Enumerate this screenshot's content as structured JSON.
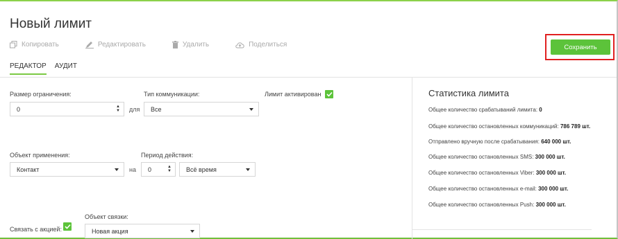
{
  "page": {
    "title": "Новый лимит"
  },
  "toolbar": {
    "copy": "Копировать",
    "edit": "Редактировать",
    "delete": "Удалить",
    "share": "Поделиться"
  },
  "save_label": "Сохранить",
  "tabs": [
    {
      "label": "РЕДАКТОР",
      "active": true
    },
    {
      "label": "АУДИТ",
      "active": false
    }
  ],
  "form": {
    "limit_size": {
      "label": "Размер ограничения:",
      "value": "0"
    },
    "for_label": "для",
    "comm_type": {
      "label": "Тип коммуникации:",
      "value": "Все"
    },
    "limit_active": {
      "label": "Лимит активирован",
      "checked": true
    },
    "apply_object": {
      "label": "Объект применения:",
      "value": "Контакт"
    },
    "on_label": "на",
    "period": {
      "label": "Период действия:",
      "count": "0",
      "value": "Всё время"
    },
    "link_action": {
      "label": "Связать с акцией:",
      "checked": true
    },
    "link_object": {
      "label": "Объект связки:",
      "value": "Новая акция"
    }
  },
  "stats": {
    "title": "Статистика лимита",
    "rows": [
      {
        "label": "Общее количество срабатываний лимита:",
        "value": "0"
      },
      {
        "label": "Общее количество остановленных коммуникаций:",
        "value": "786 789 шт."
      },
      {
        "label": "Отправлено вручную после срабатывания:",
        "value": "640 000 шт."
      },
      {
        "label": "Общее количество остановленных SMS:",
        "value": "300 000 шт."
      },
      {
        "label": "Общее количество остановленных Viber:",
        "value": "300 000 шт."
      },
      {
        "label": "Общее количество остановленных e-mail:",
        "value": "300 000 шт."
      },
      {
        "label": "Общее количество остановленных Push:",
        "value": "300 000 шт."
      }
    ]
  },
  "colors": {
    "accent": "#5cc33a",
    "highlight": "#e02020"
  }
}
